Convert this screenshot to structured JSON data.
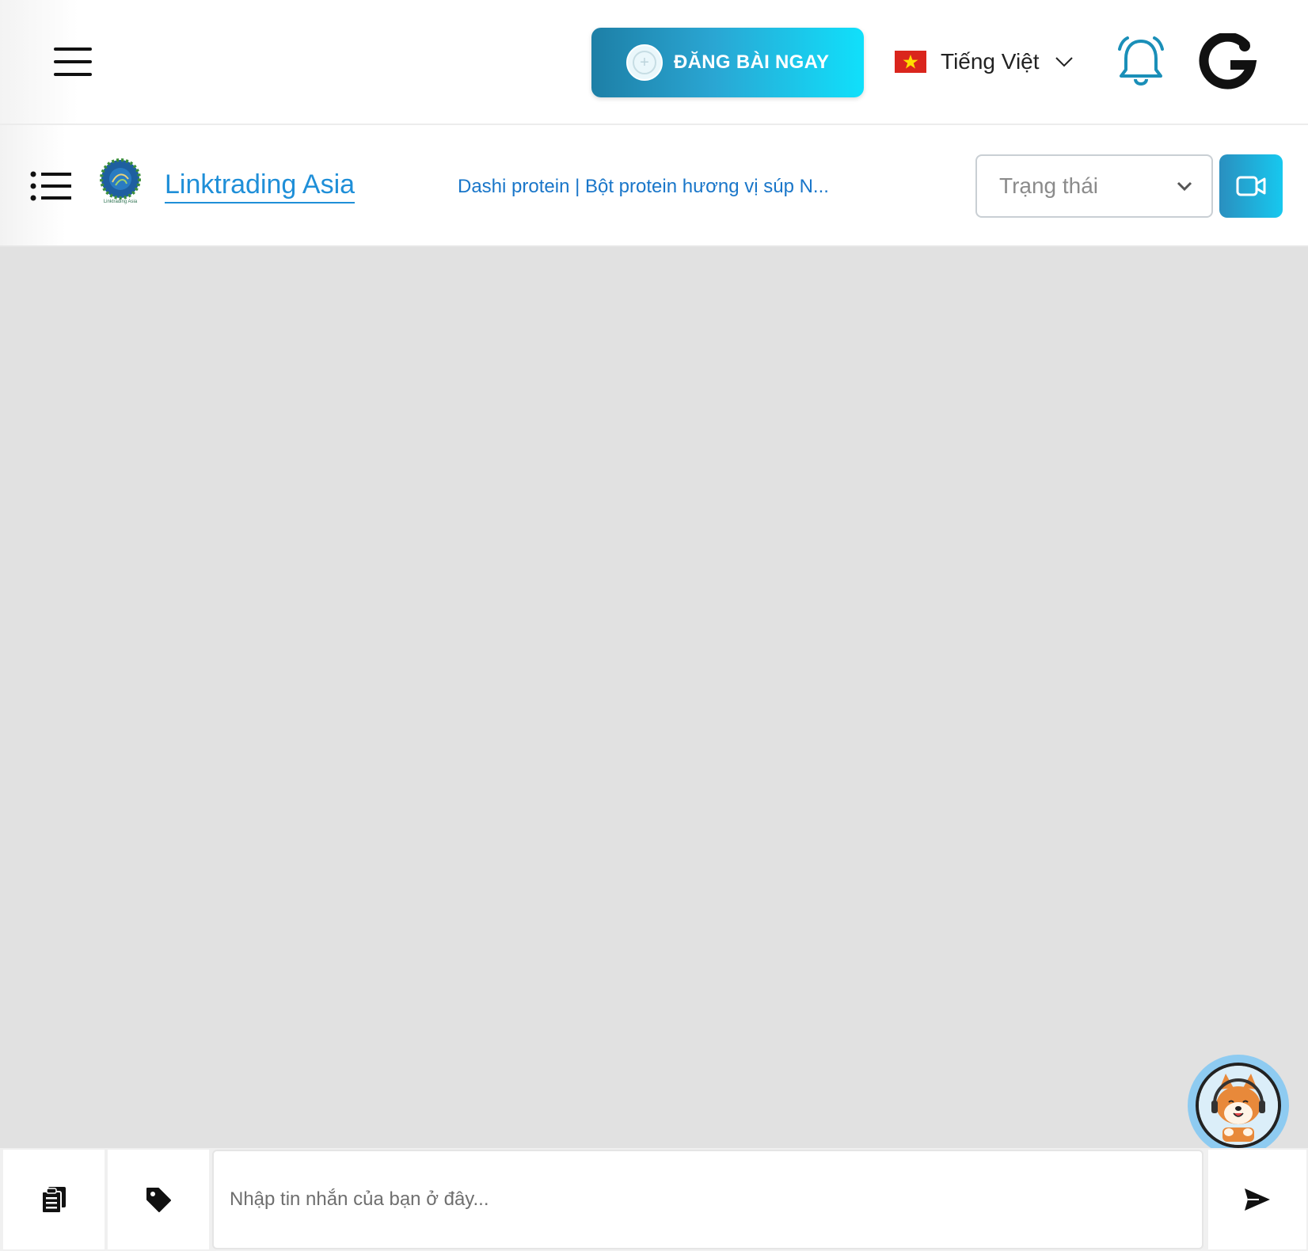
{
  "topbar": {
    "post_button_label": "ĐĂNG BÀI NGAY",
    "language_label": "Tiếng Việt"
  },
  "chat_header": {
    "shop_name": "Linktrading Asia",
    "logo_caption": "Linktrading Asia",
    "product_title": "Dashi protein | Bột protein hương vị súp N...",
    "status_placeholder": "Trạng thái"
  },
  "composer": {
    "placeholder": "Nhập tin nhắn của bạn ở đây..."
  },
  "colors": {
    "accent": "#1f8fd8",
    "button_gradient_start": "#1d7fa6",
    "button_gradient_end": "#10e0fb",
    "message_bg": "#e1e1e1"
  }
}
